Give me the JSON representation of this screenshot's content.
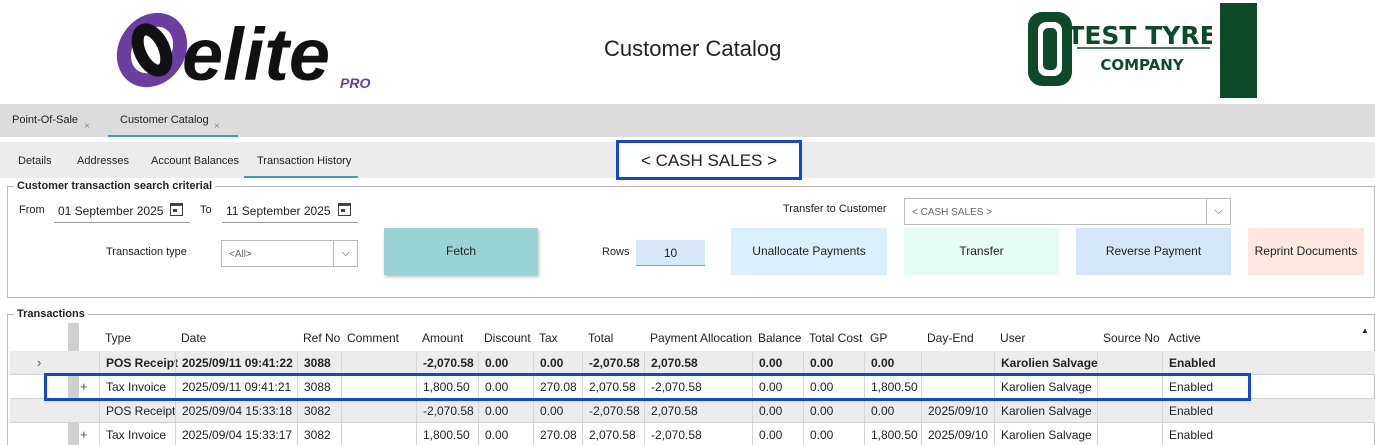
{
  "header": {
    "page_title": "Customer Catalog",
    "logo_text": "elite",
    "logo_sub": "PRO",
    "company_line1": "TEST TYRE",
    "company_line2": "COMPANY"
  },
  "top_tabs": [
    {
      "label": "Point-Of-Sale",
      "close": "×"
    },
    {
      "label": "Customer Catalog",
      "close": "×"
    }
  ],
  "sub_tabs": [
    "Details",
    "Addresses",
    "Account Balances",
    "Transaction History"
  ],
  "customer_name": "< CASH SALES >",
  "search": {
    "group_title": "Customer transaction search criterial",
    "from_label": "From",
    "from_date": "01 September 2025",
    "to_label": "To",
    "to_date": "11 September 2025",
    "transaction_type_label": "Transaction type",
    "transaction_type_value": "<All>",
    "fetch_label": "Fetch",
    "rows_label": "Rows",
    "rows_value": "10",
    "transfer_to_label": "Transfer to Customer",
    "transfer_to_value": "< CASH SALES >",
    "unallocate_label": "Unallocate Payments",
    "transfer_label": "Transfer",
    "reverse_label": "Reverse Payment",
    "reprint_label": "Reprint Documents"
  },
  "colors": {
    "accent": "#1646d8",
    "tab_underline": "#3a9fbf",
    "fetch": "#9ad3d3",
    "unallocate": "#dbeffc",
    "transfer": "#e6fbf4",
    "reverse": "#d6e6fa",
    "reprint": "#fde7e0",
    "brand_green": "#0e4a2a"
  },
  "transactions": {
    "group_title": "Transactions",
    "columns": [
      "Type",
      "Date",
      "Ref No",
      "Comment",
      "Amount",
      "Discount",
      "Tax",
      "Total",
      "Payment Allocation",
      "Balance",
      "Total Cost",
      "GP",
      "Day-End",
      "User",
      "Source No",
      "Active"
    ],
    "rows": [
      {
        "expander": "›",
        "cells": [
          "POS Receipt",
          "2025/09/11 09:41:22",
          "3088",
          "",
          "-2,070.58",
          "0.00",
          "0.00",
          "-2,070.58",
          "2,070.58",
          "0.00",
          "0.00",
          "0.00",
          "",
          "Karolien Salvage",
          "",
          "Enabled"
        ]
      },
      {
        "expander": "+",
        "cells": [
          "Tax Invoice",
          "2025/09/11 09:41:21",
          "3088",
          "",
          "1,800.50",
          "0.00",
          "270.08",
          "2,070.58",
          "-2,070.58",
          "0.00",
          "0.00",
          "1,800.50",
          "",
          "Karolien Salvage",
          "",
          "Enabled"
        ]
      },
      {
        "expander": "",
        "cells": [
          "POS Receipt",
          "2025/09/04 15:33:18",
          "3082",
          "",
          "-2,070.58",
          "0.00",
          "0.00",
          "-2,070.58",
          "2,070.58",
          "0.00",
          "0.00",
          "0.00",
          "2025/09/10",
          "Karolien Salvage",
          "",
          "Enabled"
        ]
      },
      {
        "expander": "+",
        "cells": [
          "Tax Invoice",
          "2025/09/04 15:33:17",
          "3082",
          "",
          "1,800.50",
          "0.00",
          "270.08",
          "2,070.58",
          "-2,070.58",
          "0.00",
          "0.00",
          "1,800.50",
          "2025/09/10",
          "Karolien Salvage",
          "",
          "Enabled"
        ]
      }
    ]
  }
}
